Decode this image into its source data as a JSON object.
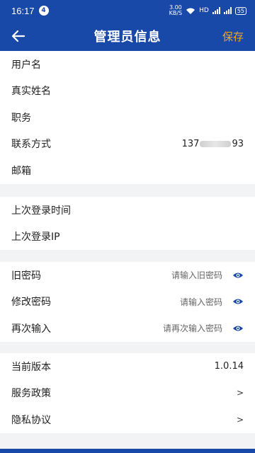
{
  "status_bar": {
    "time": "16:17",
    "notification_count": "4",
    "speed_value": "3.00",
    "speed_unit": "KB/S",
    "network": "HD",
    "battery": "55"
  },
  "header": {
    "title": "管理员信息",
    "save_label": "保存",
    "back_icon": "arrow-left-icon"
  },
  "profile": {
    "username_label": "用户名",
    "realname_label": "真实姓名",
    "position_label": "职务",
    "contact_label": "联系方式",
    "contact_prefix": "137",
    "contact_suffix": "93",
    "email_label": "邮箱"
  },
  "login": {
    "last_time_label": "上次登录时间",
    "last_ip_label": "上次登录IP"
  },
  "password": {
    "old_label": "旧密码",
    "old_placeholder": "请输入旧密码",
    "new_label": "修改密码",
    "new_placeholder": "请输入密码",
    "confirm_label": "再次输入",
    "confirm_placeholder": "请再次输入密码",
    "eye_icon": "eye-icon"
  },
  "about": {
    "version_label": "当前版本",
    "version_value": "1.0.14",
    "service_label": "服务政策",
    "privacy_label": "隐私协议",
    "arrow": ">"
  },
  "colors": {
    "primary": "#1849a8",
    "accent": "#f5a623",
    "eye": "#1849a8"
  }
}
